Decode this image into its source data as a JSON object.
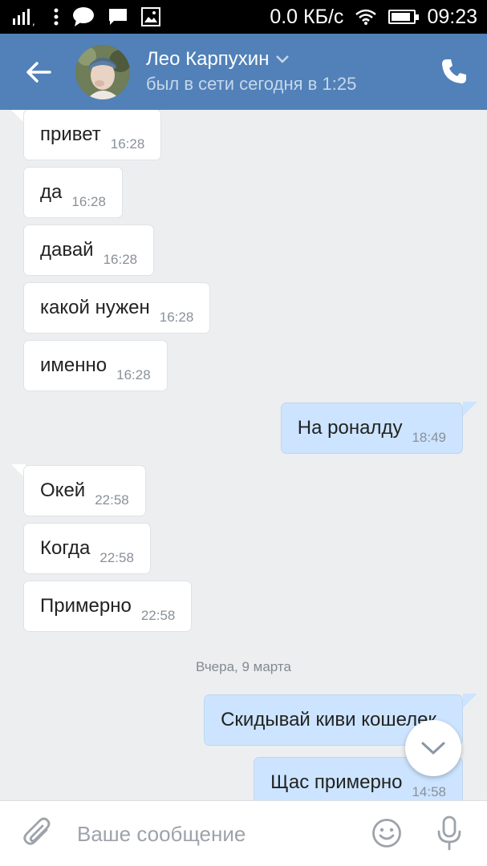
{
  "statusbar": {
    "net_speed": "0.0 КБ/с",
    "time": "09:23",
    "battery_level": 0.85,
    "icons": [
      "signal-icon",
      "chat-bubble-icon",
      "message-icon",
      "image-icon",
      "wifi-icon",
      "battery-icon"
    ]
  },
  "header": {
    "contact_name": "Лео Карпухин",
    "status": "был в сети сегодня в 1:25",
    "icons": [
      "back-arrow-icon",
      "chevron-down-icon",
      "phone-icon"
    ],
    "accent": "#5181b8"
  },
  "messages": [
    {
      "dir": "in",
      "text": "привет",
      "time": "16:28"
    },
    {
      "dir": "in",
      "text": "да",
      "time": "16:28"
    },
    {
      "dir": "in",
      "text": "давай",
      "time": "16:28"
    },
    {
      "dir": "in",
      "text": "какой нужен",
      "time": "16:28"
    },
    {
      "dir": "in",
      "text": "именно",
      "time": "16:28"
    },
    {
      "dir": "out",
      "text": "На роналду",
      "time": "18:49"
    },
    {
      "dir": "in",
      "text": "Окей",
      "time": "22:58"
    },
    {
      "dir": "in",
      "text": "Когда",
      "time": "22:58"
    },
    {
      "dir": "in",
      "text": "Примерно",
      "time": "22:58"
    },
    {
      "dir": "out",
      "text": "Скидывай киви кошелек",
      "time": ""
    },
    {
      "dir": "out",
      "text": "Щас примерно",
      "time": "14:58"
    }
  ],
  "date_separator": "Вчера, 9 марта",
  "composer": {
    "placeholder": "Ваше сообщение",
    "value": "",
    "icons": [
      "paperclip-icon",
      "emoji-icon",
      "microphone-icon"
    ]
  },
  "colors": {
    "incoming_bubble": "#ffffff",
    "outgoing_bubble": "#cce4ff",
    "background": "#edeef0"
  }
}
